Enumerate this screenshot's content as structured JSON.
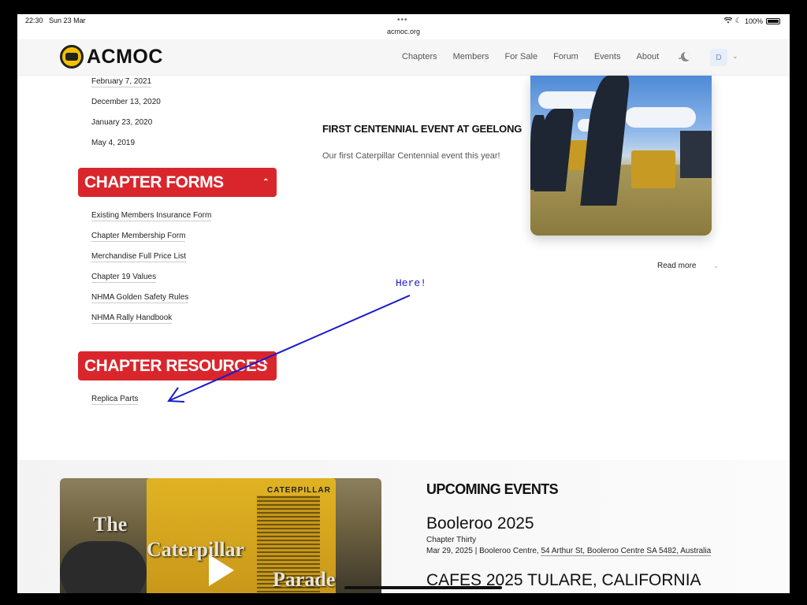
{
  "status": {
    "time": "22:30",
    "date": "Sun 23 Mar",
    "url": "acmoc.org",
    "battery": "100%"
  },
  "nav": {
    "logo_text": "ACMOC",
    "links": [
      "Chapters",
      "Members",
      "For Sale",
      "Forum",
      "Events",
      "About"
    ],
    "avatar_letter": "D"
  },
  "dates": [
    "February 7, 2021",
    "December 13, 2020",
    "January 23, 2020",
    "May 4, 2019"
  ],
  "chapter_forms": {
    "title": "CHAPTER FORMS",
    "items": [
      "Existing Members Insurance Form",
      "Chapter Membership Form",
      "Merchandise Full Price List",
      "Chapter 19 Values",
      "NHMA Golden Safety Rules",
      "NHMA Rally Handbook"
    ]
  },
  "chapter_resources": {
    "title": "CHAPTER RESOURCES",
    "items": [
      "Replica Parts"
    ]
  },
  "article": {
    "title": "FIRST CENTENNIAL EVENT AT GEELONG",
    "text": "Our first Caterpillar Centennial event this year!",
    "read_more": "Read more"
  },
  "annotation": {
    "text": "Here!",
    "color": "#1a1acc"
  },
  "video": {
    "line1": "The",
    "line2": "Caterpillar",
    "line3": "Parade",
    "brand": "CATERPILLAR"
  },
  "events": {
    "heading": "UPCOMING EVENTS",
    "items": [
      {
        "name": "Booleroo 2025",
        "chapter": "Chapter Thirty",
        "date_venue": "Mar 29, 2025 | Booleroo Centre, ",
        "address": "54 Arthur St, Booleroo Centre SA 5482, Australia"
      },
      {
        "name": "CAFES 2025 TULARE, CALIFORNIA"
      }
    ]
  },
  "colors": {
    "accent_red": "#d9262c"
  }
}
